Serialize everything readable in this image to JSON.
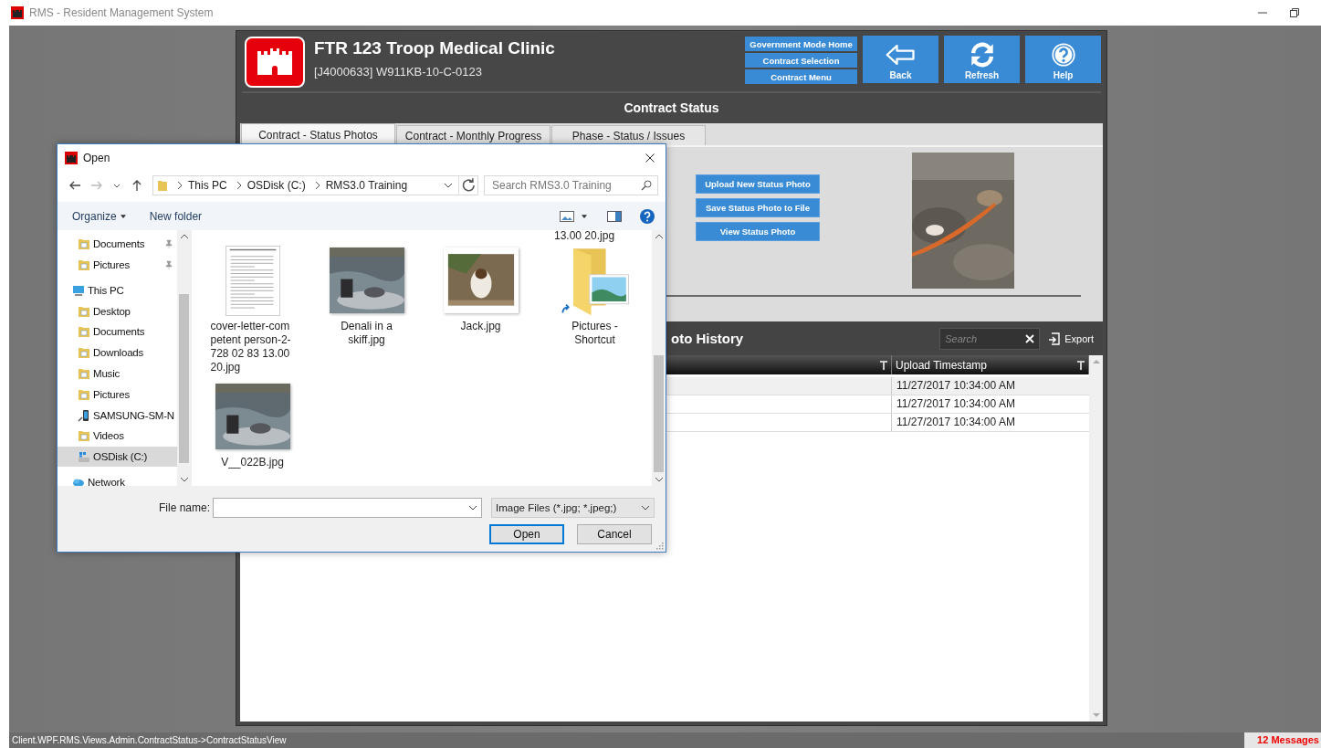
{
  "window": {
    "title": "RMS - Resident Management System"
  },
  "header": {
    "title": "FTR 123 Troop Medical Clinic",
    "subtitle": "[J4000633] W911KB-10-C-0123",
    "nav_links": [
      "Government Mode Home",
      "Contract Selection",
      "Contract Menu"
    ],
    "buttons": [
      {
        "label": "Back",
        "kind": "back"
      },
      {
        "label": "Refresh",
        "kind": "refresh"
      },
      {
        "label": "Help",
        "kind": "help"
      }
    ]
  },
  "page_title": "Contract Status",
  "tabs": [
    {
      "label": "Contract - Status Photos",
      "selected": true
    },
    {
      "label": "Contract - Monthly Progress",
      "selected": false
    },
    {
      "label": "Phase - Status / Issues",
      "selected": false
    }
  ],
  "photo_actions": [
    "Upload New Status Photo",
    "Save Status Photo to File",
    "View Status Photo"
  ],
  "history": {
    "title": "oto History",
    "search": {
      "placeholder": "Search"
    },
    "export": "Export",
    "columns": [
      "Upload Timestamp"
    ],
    "rows": [
      {
        "timestamp": "11/27/2017 10:34:00 AM",
        "selected": true
      },
      {
        "timestamp": "11/27/2017 10:34:00 AM",
        "selected": false
      },
      {
        "timestamp": "11/27/2017 10:34:00 AM",
        "selected": false
      }
    ]
  },
  "dialog": {
    "title": "Open",
    "path": [
      "This PC",
      "OSDisk (C:)",
      "RMS3.0 Training"
    ],
    "search": {
      "placeholder": "Search RMS3.0 Training"
    },
    "toolbar": {
      "organize": "Organize",
      "new_folder": "New folder"
    },
    "nav": [
      {
        "label": "Documents",
        "kind": "folder",
        "pinned": true,
        "selected": false
      },
      {
        "label": "Pictures",
        "kind": "folder",
        "pinned": true,
        "selected": false
      },
      {
        "label": "This PC",
        "kind": "computer",
        "pinned": false,
        "selected": false,
        "children": [
          {
            "label": "Desktop",
            "kind": "folder",
            "pinned": false,
            "selected": false
          },
          {
            "label": "Documents",
            "kind": "folder",
            "pinned": false,
            "selected": false
          },
          {
            "label": "Downloads",
            "kind": "folder",
            "pinned": false,
            "selected": false
          },
          {
            "label": "Music",
            "kind": "folder",
            "pinned": false,
            "selected": false
          },
          {
            "label": "Pictures",
            "kind": "folder",
            "pinned": false,
            "selected": false
          },
          {
            "label": "SAMSUNG-SM-N",
            "kind": "device",
            "pinned": false,
            "selected": false
          },
          {
            "label": "Videos",
            "kind": "folder",
            "pinned": false,
            "selected": false
          },
          {
            "label": "OSDisk (C:)",
            "kind": "drive",
            "pinned": false,
            "selected": true
          }
        ]
      },
      {
        "label": "Network",
        "kind": "network",
        "pinned": false,
        "selected": false
      }
    ],
    "partial_label": "13.00 20.jpg",
    "files": [
      {
        "name": "cover-letter-com petent person-2-728 02 83 13.00 20.jpg",
        "kind": "document"
      },
      {
        "name": "Denali in a skiff.jpg",
        "kind": "picture"
      },
      {
        "name": "Jack.jpg",
        "kind": "picture"
      },
      {
        "name": "Pictures - Shortcut",
        "kind": "shortcut"
      },
      {
        "name": "V__022B.jpg",
        "kind": "picture"
      }
    ],
    "file_name": {
      "label": "File name:"
    },
    "filter": "Image Files (*.jpg; *.jpeg;)",
    "buttons": [
      {
        "label": "Open",
        "kind": "primary"
      },
      {
        "label": "Cancel",
        "kind": "secondary"
      }
    ]
  },
  "status_bar": {
    "view": "Client.WPF.RMS.Views.Admin.ContractStatus->ContractStatusView",
    "messages": "12 Messages"
  }
}
